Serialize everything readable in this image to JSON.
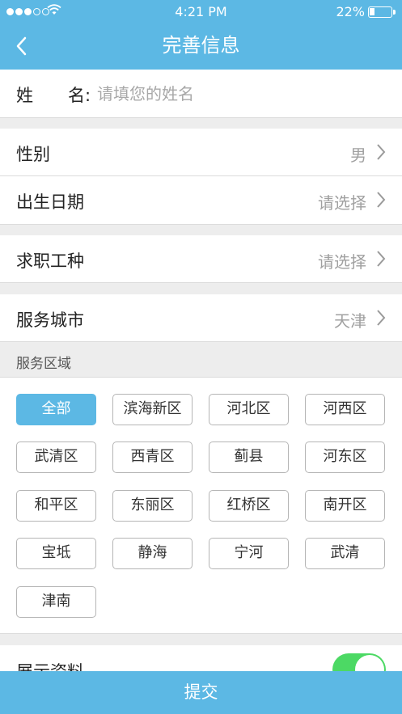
{
  "status_bar": {
    "time": "4:21 PM",
    "battery": "22%",
    "battery_level": 0.22,
    "signal_bars": 3,
    "signal_total": 5
  },
  "header": {
    "title": "完善信息",
    "back_icon": "chevron-left-icon"
  },
  "name_field": {
    "label_a": "姓",
    "label_b": "名:",
    "value": "",
    "placeholder": "请填您的姓名"
  },
  "rows": {
    "gender": {
      "label": "性别",
      "value": "男"
    },
    "birth": {
      "label": "出生日期",
      "value": "请选择"
    },
    "job": {
      "label": "求职工种",
      "value": "请选择"
    },
    "city": {
      "label": "服务城市",
      "value": "天津"
    }
  },
  "area_section": {
    "label": "服务区域",
    "chips": [
      {
        "label": "全部",
        "selected": true
      },
      {
        "label": "滨海新区",
        "selected": false
      },
      {
        "label": "河北区",
        "selected": false
      },
      {
        "label": "河西区",
        "selected": false
      },
      {
        "label": "武清区",
        "selected": false
      },
      {
        "label": "西青区",
        "selected": false
      },
      {
        "label": "蓟县",
        "selected": false
      },
      {
        "label": "河东区",
        "selected": false
      },
      {
        "label": "和平区",
        "selected": false
      },
      {
        "label": "东丽区",
        "selected": false
      },
      {
        "label": "红桥区",
        "selected": false
      },
      {
        "label": "南开区",
        "selected": false
      },
      {
        "label": "宝坻",
        "selected": false
      },
      {
        "label": "静海",
        "selected": false
      },
      {
        "label": "宁河",
        "selected": false
      },
      {
        "label": "武清",
        "selected": false
      },
      {
        "label": "津南",
        "selected": false
      }
    ]
  },
  "display_profile": {
    "label": "展示资料",
    "enabled": true
  },
  "submit": {
    "label": "提交"
  },
  "colors": {
    "accent": "#5cb8e4",
    "toggle_on": "#4cd964",
    "placeholder": "#a8a8a8"
  }
}
